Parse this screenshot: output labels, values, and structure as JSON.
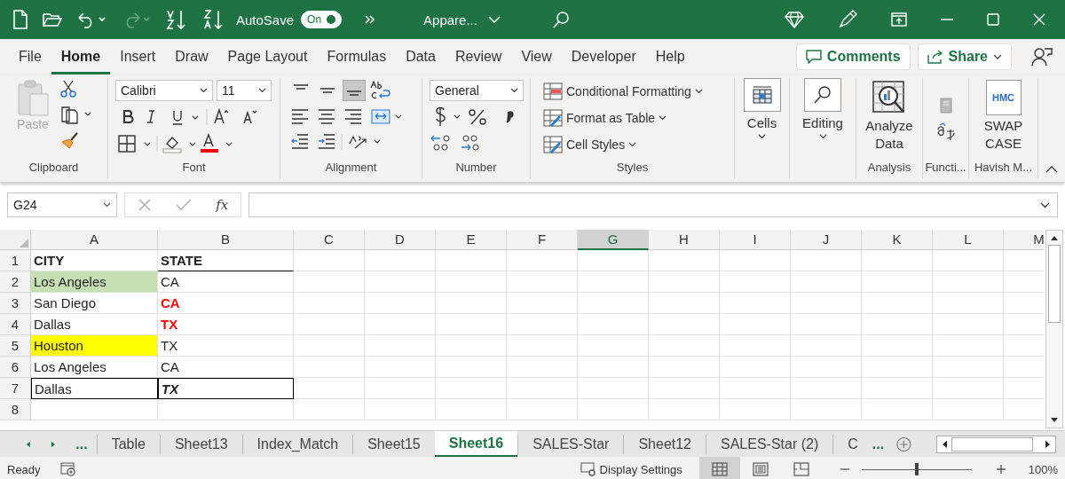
{
  "title_bar": {
    "autosave_label": "AutoSave",
    "autosave": {
      "on": true,
      "label": "On"
    },
    "redo_disabled": true,
    "document_title": "Appare..."
  },
  "menu": {
    "tabs": [
      {
        "label": "File",
        "selected": false
      },
      {
        "label": "Home",
        "selected": true
      },
      {
        "label": "Insert",
        "selected": false
      },
      {
        "label": "Draw",
        "selected": false
      },
      {
        "label": "Page Layout",
        "selected": false
      },
      {
        "label": "Formulas",
        "selected": false
      },
      {
        "label": "Data",
        "selected": false
      },
      {
        "label": "Review",
        "selected": false
      },
      {
        "label": "View",
        "selected": false
      },
      {
        "label": "Developer",
        "selected": false
      },
      {
        "label": "Help",
        "selected": false
      }
    ],
    "comments": "Comments",
    "share": "Share"
  },
  "ribbon": {
    "clipboard": {
      "paste": "Paste",
      "paste_disabled": true,
      "label": "Clipboard"
    },
    "font": {
      "name": "Calibri",
      "size": "11",
      "label": "Font"
    },
    "alignment": {
      "vertical": [
        {
          "selected": false
        },
        {
          "selected": false
        },
        {
          "selected": true
        }
      ],
      "label": "Alignment"
    },
    "number": {
      "format": "General",
      "label": "Number"
    },
    "styles": {
      "items": [
        "Conditional Formatting",
        "Format as Table",
        "Cell Styles"
      ],
      "label": "Styles"
    },
    "cells": "Cells",
    "editing": "Editing",
    "analysis": {
      "button": "Analyze Data",
      "label": "Analysis"
    },
    "functions": {
      "label": "Functi..."
    },
    "addin": {
      "logo": "HMC",
      "button": "SWAP CASE",
      "label": "Havish M..."
    }
  },
  "formula_bar": {
    "name_box": "G24",
    "function_label": "fx"
  },
  "grid": {
    "columns": [
      {
        "label": "A",
        "selected": false
      },
      {
        "label": "B",
        "selected": false
      },
      {
        "label": "C",
        "selected": false
      },
      {
        "label": "D",
        "selected": false
      },
      {
        "label": "E",
        "selected": false
      },
      {
        "label": "F",
        "selected": false
      },
      {
        "label": "G",
        "selected": true
      },
      {
        "label": "H",
        "selected": false
      },
      {
        "label": "I",
        "selected": false
      },
      {
        "label": "J",
        "selected": false
      },
      {
        "label": "K",
        "selected": false
      },
      {
        "label": "L",
        "selected": false
      },
      {
        "label": "M",
        "selected": false
      }
    ],
    "rows": [
      {
        "number": "1",
        "cells": [
          {
            "text": "CITY",
            "bold": true
          },
          {
            "text": "STATE",
            "bold": true,
            "border_bottom": true
          }
        ]
      },
      {
        "number": "2",
        "cells": [
          {
            "text": "Los Angeles",
            "highlight": {
              "color": "#c6e0b4"
            }
          },
          {
            "text": "CA"
          }
        ]
      },
      {
        "number": "3",
        "cells": [
          {
            "text": "San Diego"
          },
          {
            "text": "CA",
            "bold": true,
            "font": {
              "color": "#ff0000"
            }
          }
        ]
      },
      {
        "number": "4",
        "cells": [
          {
            "text": "Dallas"
          },
          {
            "text": "TX",
            "bold": true,
            "font": {
              "color": "#ff0000"
            }
          }
        ]
      },
      {
        "number": "5",
        "cells": [
          {
            "text": "Houston",
            "highlight": {
              "color": "#ffff00"
            }
          },
          {
            "text": "TX"
          }
        ]
      },
      {
        "number": "6",
        "cells": [
          {
            "text": "Los Angeles"
          },
          {
            "text": "CA"
          }
        ]
      },
      {
        "number": "7",
        "cells": [
          {
            "text": "Dallas",
            "boxed": true
          },
          {
            "text": "TX",
            "bold": true,
            "italic": true,
            "boxed": true
          }
        ]
      },
      {
        "number": "8",
        "cells": []
      }
    ]
  },
  "sheet_tabs": {
    "more_left": "...",
    "tabs": [
      {
        "label": "Table",
        "selected": false
      },
      {
        "label": "Sheet13",
        "selected": false
      },
      {
        "label": "Index_Match",
        "selected": false
      },
      {
        "label": "Sheet15",
        "selected": false
      },
      {
        "label": "Sheet16",
        "selected": true
      },
      {
        "label": "SALES-Star",
        "selected": false
      },
      {
        "label": "Sheet12",
        "selected": false
      },
      {
        "label": "SALES-Star (2)",
        "selected": false
      },
      {
        "label": "C",
        "selected": false
      }
    ],
    "more_right": "..."
  },
  "status_bar": {
    "status": "Ready",
    "display_settings": "Display Settings",
    "views": [
      {
        "selected": true
      },
      {
        "selected": false
      },
      {
        "selected": false
      }
    ],
    "zoom": {
      "level": 0.5,
      "label": "100%"
    }
  }
}
